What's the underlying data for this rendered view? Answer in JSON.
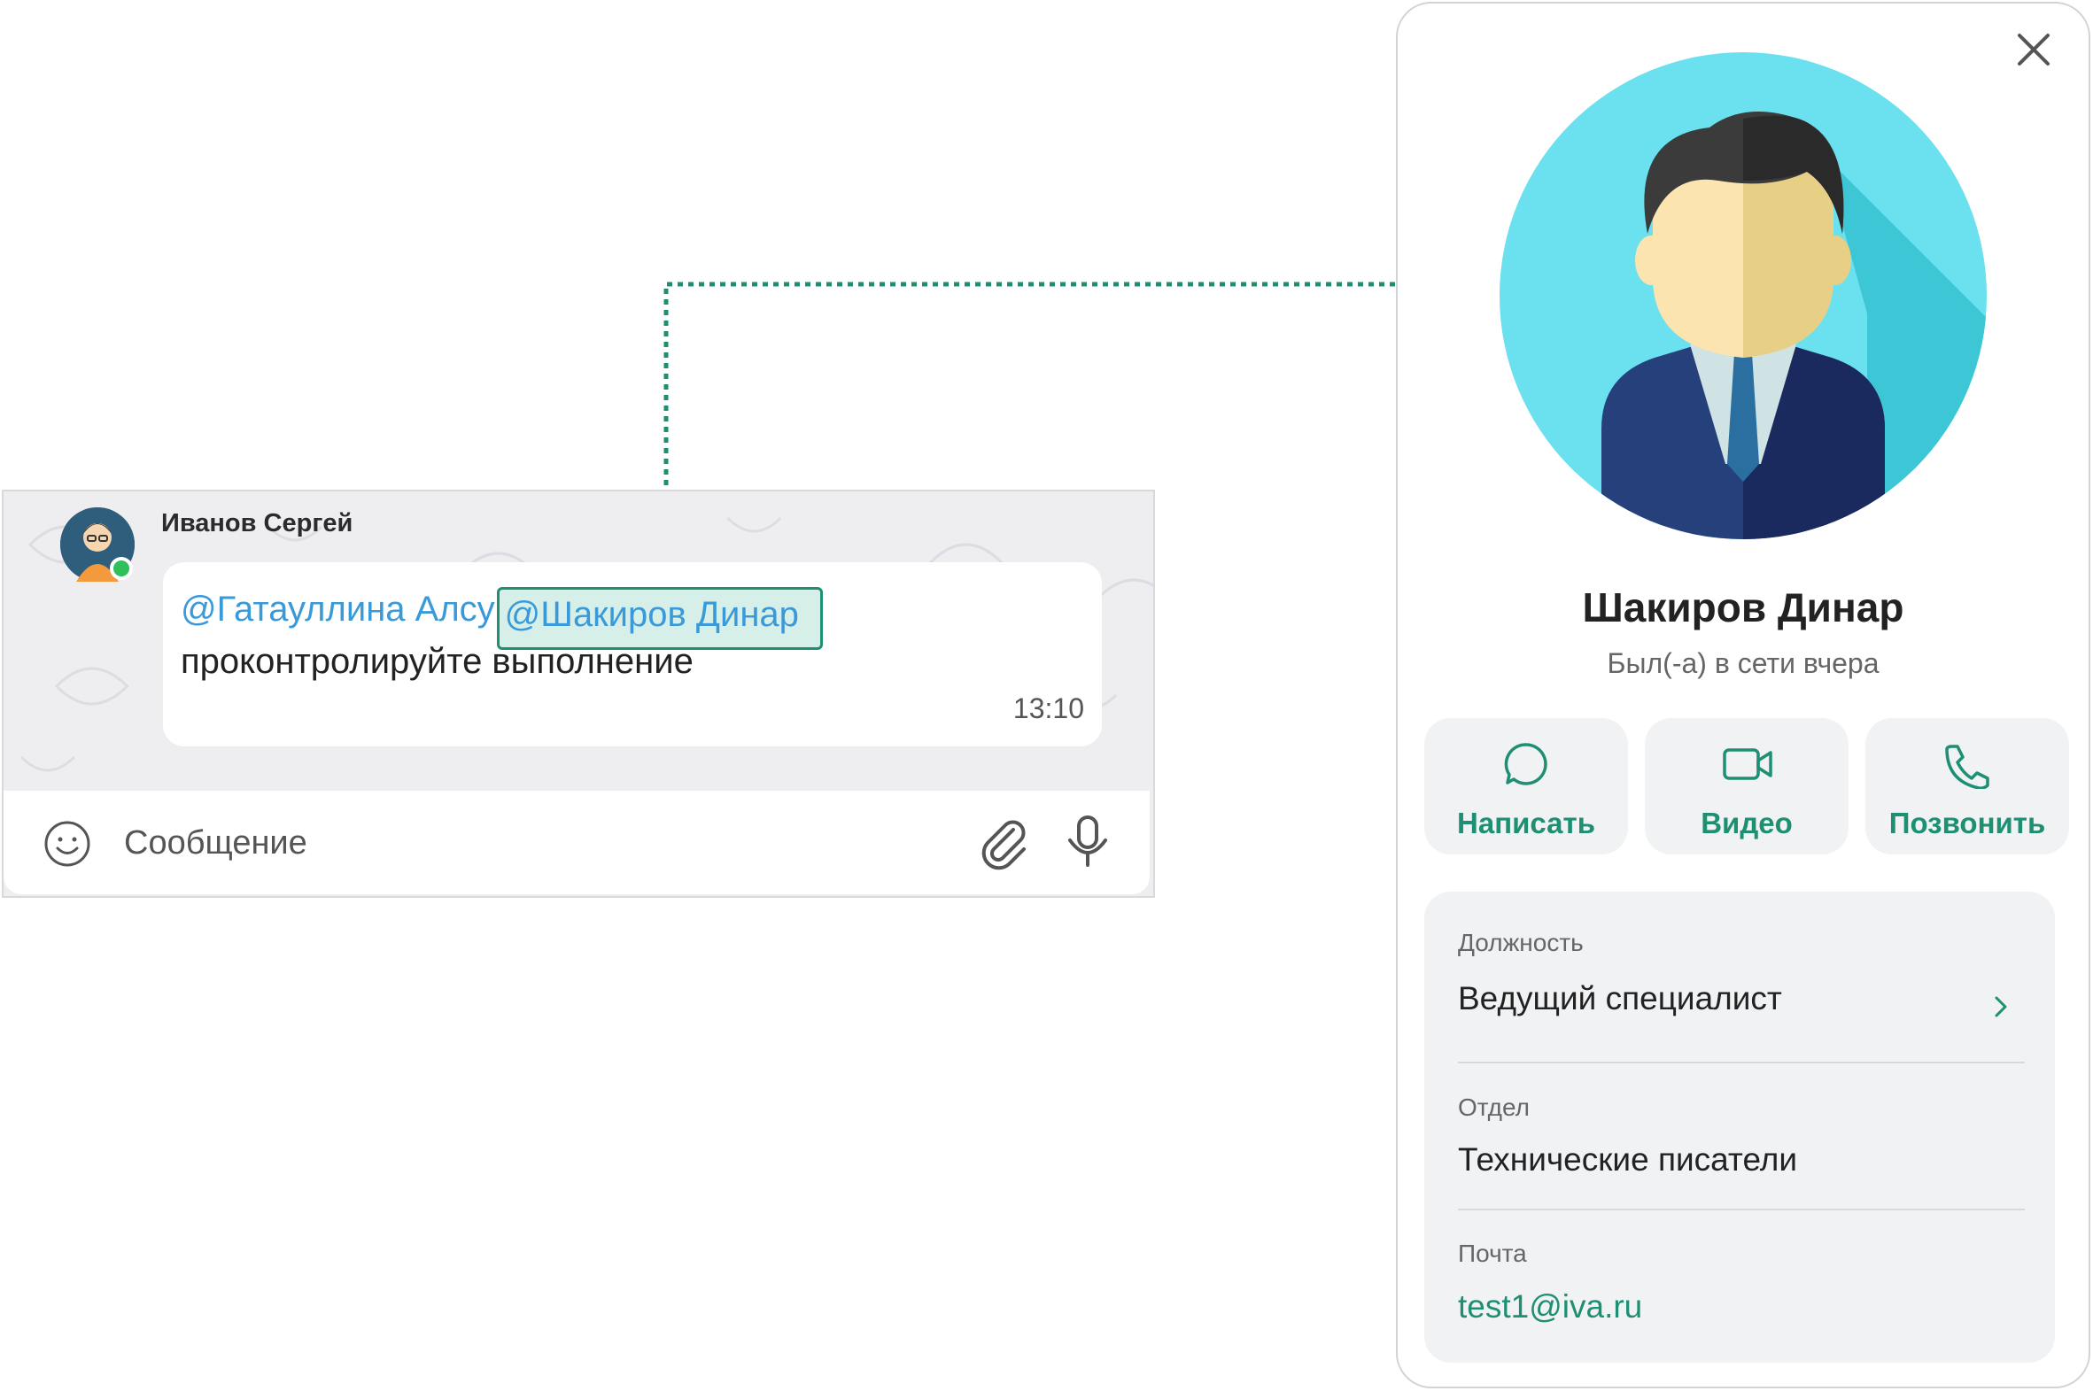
{
  "chat": {
    "sender": "Иванов Сергей",
    "mention_1": "@Гатауллина Алсу",
    "mention_2": "@Шакиров Динар",
    "message_text": "проконтролируйте выполнение",
    "time": "13:10",
    "composer_placeholder": "Сообщение",
    "sender_online": true
  },
  "profile": {
    "name": "Шакиров Динар",
    "status": "Был(-а) в сети вчера",
    "actions": [
      {
        "label": "Написать",
        "icon": "chat-bubble-icon"
      },
      {
        "label": "Видео",
        "icon": "video-camera-icon"
      },
      {
        "label": "Позвонить",
        "icon": "phone-icon"
      }
    ],
    "fields": [
      {
        "label": "Должность",
        "value": "Ведущий специалист"
      },
      {
        "label": "Отдел",
        "value": "Технические писатели"
      },
      {
        "label": "Почта",
        "value": "test1@iva.ru"
      }
    ]
  },
  "colors": {
    "accent": "#1f8f73",
    "mention": "#3a9ad9",
    "mention_highlight": "#d6efe9",
    "online": "#2fbf5b",
    "avatar_bg": "#6be0ee"
  }
}
